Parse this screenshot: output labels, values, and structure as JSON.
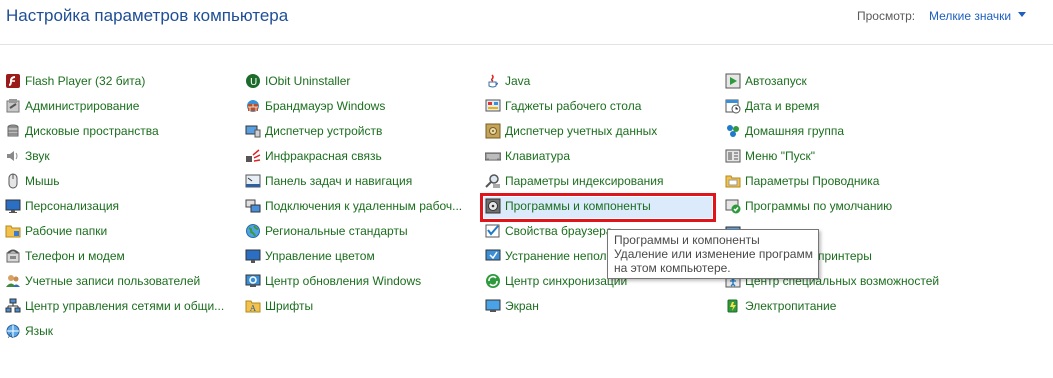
{
  "header": {
    "title": "Настройка параметров компьютера",
    "view_label": "Просмотр:",
    "view_value": "Мелкие значки"
  },
  "items": [
    {
      "label": "Flash Player (32 бита)",
      "name": "item-flash-player",
      "icon": "flash-icon"
    },
    {
      "label": "Администрирование",
      "name": "item-administration",
      "icon": "admin-tools-icon"
    },
    {
      "label": "Дисковые пространства",
      "name": "item-storage-spaces",
      "icon": "disk-stack-icon"
    },
    {
      "label": "Звук",
      "name": "item-sound",
      "icon": "speaker-icon"
    },
    {
      "label": "Мышь",
      "name": "item-mouse",
      "icon": "mouse-icon"
    },
    {
      "label": "Персонализация",
      "name": "item-personalization",
      "icon": "monitor-icon"
    },
    {
      "label": "Рабочие папки",
      "name": "item-work-folders",
      "icon": "folder-icon"
    },
    {
      "label": "Телефон и модем",
      "name": "item-phone-modem",
      "icon": "phone-icon"
    },
    {
      "label": "Учетные записи пользователей",
      "name": "item-user-accounts",
      "icon": "users-icon"
    },
    {
      "label": "Центр управления сетями и общи...",
      "name": "item-network-center",
      "icon": "network-icon"
    },
    {
      "label": "Язык",
      "name": "item-language",
      "icon": "language-icon"
    },
    {
      "label": "IObit Uninstaller",
      "name": "item-iobit-uninstaller",
      "icon": "iobit-icon"
    },
    {
      "label": "Брандмауэр Windows",
      "name": "item-firewall",
      "icon": "firewall-icon"
    },
    {
      "label": "Диспетчер устройств",
      "name": "item-device-manager",
      "icon": "device-manager-icon"
    },
    {
      "label": "Инфракрасная связь",
      "name": "item-infrared",
      "icon": "infrared-icon"
    },
    {
      "label": "Панель задач и навигация",
      "name": "item-taskbar",
      "icon": "taskbar-icon"
    },
    {
      "label": "Подключения к удаленным рабоч...",
      "name": "item-remote-connections",
      "icon": "remote-icon"
    },
    {
      "label": "Региональные стандарты",
      "name": "item-region",
      "icon": "globe-icon"
    },
    {
      "label": "Управление цветом",
      "name": "item-color-management",
      "icon": "color-monitor-icon"
    },
    {
      "label": "Центр обновления Windows",
      "name": "item-windows-update",
      "icon": "update-icon"
    },
    {
      "label": "Шрифты",
      "name": "item-fonts",
      "icon": "font-icon"
    },
    {
      "label": "Java",
      "name": "item-java",
      "icon": "java-icon"
    },
    {
      "label": "Гаджеты рабочего стола",
      "name": "item-gadgets",
      "icon": "gadgets-icon"
    },
    {
      "label": "Диспетчер учетных данных",
      "name": "item-credential-manager",
      "icon": "vault-icon"
    },
    {
      "label": "Клавиатура",
      "name": "item-keyboard",
      "icon": "keyboard-icon"
    },
    {
      "label": "Параметры индексирования",
      "name": "item-indexing",
      "icon": "search-index-icon"
    },
    {
      "label": "Программы и компоненты",
      "name": "item-programs-features",
      "icon": "programs-icon"
    },
    {
      "label": "Свойства браузера",
      "name": "item-browser-properties",
      "icon": "browser-icon"
    },
    {
      "label": "Устранение непола",
      "name": "item-troubleshooting",
      "icon": "troubleshoot-icon"
    },
    {
      "label": "Центр синхронизации",
      "name": "item-sync-center",
      "icon": "sync-icon"
    },
    {
      "label": "Экран",
      "name": "item-display",
      "icon": "display-icon"
    },
    {
      "label": "Автозапуск",
      "name": "item-autoplay",
      "icon": "autoplay-icon"
    },
    {
      "label": "Дата и время",
      "name": "item-date-time",
      "icon": "calendar-icon"
    },
    {
      "label": "Домашняя группа",
      "name": "item-homegroup",
      "icon": "homegroup-icon"
    },
    {
      "label": "Меню \"Пуск\"",
      "name": "item-start-menu",
      "icon": "start-menu-icon"
    },
    {
      "label": "Параметры Проводника",
      "name": "item-explorer-options",
      "icon": "explorer-options-icon"
    },
    {
      "label": "Программы по умолчанию",
      "name": "item-default-programs",
      "icon": "default-programs-icon"
    },
    {
      "label": "принтеры",
      "name": "item-printers",
      "icon": "printer-icon"
    },
    {
      "label": "Центр специальных возможностей",
      "name": "item-ease-of-access",
      "icon": "accessibility-icon"
    },
    {
      "label": "Электропитание",
      "name": "item-power",
      "icon": "power-icon"
    }
  ],
  "tooltip": {
    "line1": "Программы и компоненты",
    "line2": "Удаление или изменение программ",
    "line3": "на этом компьютере."
  }
}
